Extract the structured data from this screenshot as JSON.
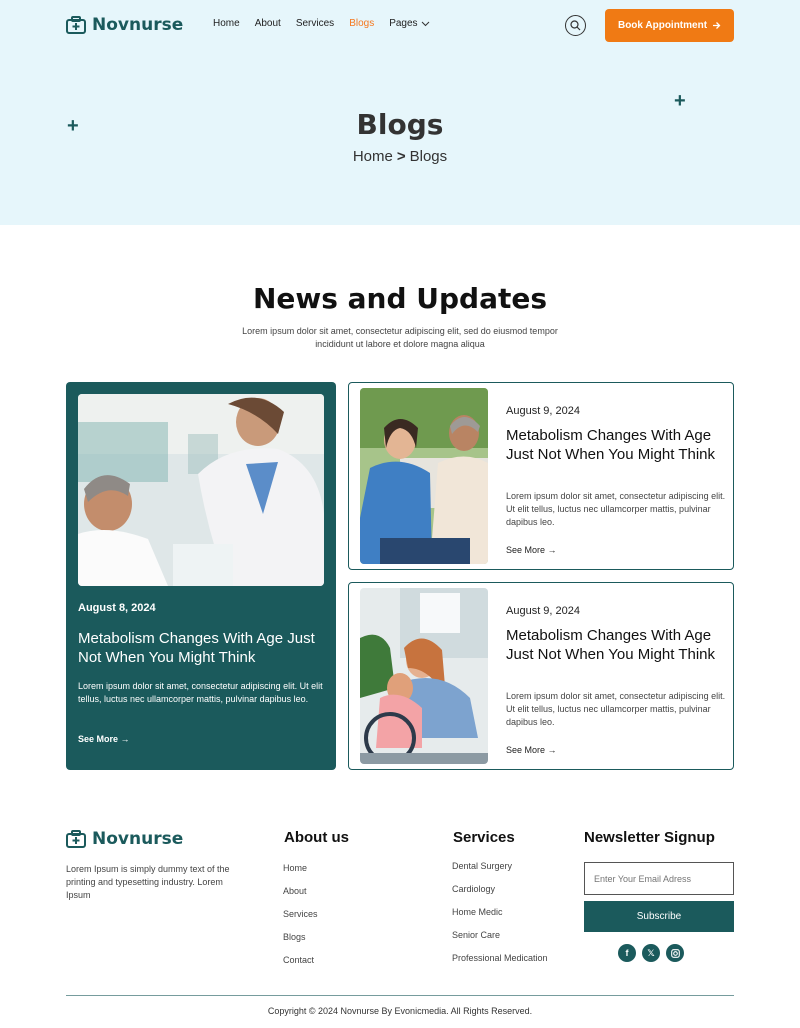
{
  "brand": {
    "name": "Novnurse"
  },
  "nav": {
    "items": [
      "Home",
      "About",
      "Services",
      "Blogs",
      "Pages"
    ],
    "active": "Blogs",
    "book_label": "Book Appointment"
  },
  "hero": {
    "title": "Blogs",
    "crumb_home": "Home",
    "crumb_sep": ">",
    "crumb_current": "Blogs"
  },
  "news": {
    "title": "News and Updates",
    "subtitle": "Lorem ipsum dolor sit amet, consectetur adipiscing elit, sed do eiusmod tempor incididunt ut labore et dolore magna aliqua",
    "featured": {
      "date": "August 8, 2024",
      "title": "Metabolism Changes With Age Just Not When You Might Think",
      "text": "Lorem ipsum dolor sit amet, consectetur adipiscing elit. Ut elit tellus, luctus nec ullamcorper mattis, pulvinar dapibus leo.",
      "more": "See More"
    },
    "cards": [
      {
        "date": "August 9, 2024",
        "title": "Metabolism Changes With Age Just Not When You Might Think",
        "text": "Lorem ipsum dolor sit amet, consectetur adipiscing elit. Ut elit tellus, luctus nec ullamcorper mattis, pulvinar dapibus leo.",
        "more": "See More"
      },
      {
        "date": "August 9, 2024",
        "title": "Metabolism Changes With Age Just Not When You Might Think",
        "text": "Lorem ipsum dolor sit amet, consectetur adipiscing elit. Ut elit tellus, luctus nec ullamcorper mattis, pulvinar dapibus leo.",
        "more": "See More"
      }
    ]
  },
  "footer": {
    "brand": "Novnurse",
    "desc": "Lorem Ipsum is simply dummy text of the printing and typesetting industry. Lorem Ipsum",
    "about": {
      "title": "About us",
      "links": [
        "Home",
        "About",
        "Services",
        "Blogs",
        "Contact"
      ]
    },
    "services": {
      "title": "Services",
      "links": [
        "Dental Surgery",
        "Cardiology",
        "Home Medic",
        "Senior Care",
        "Professional Medication"
      ]
    },
    "newsletter": {
      "title": "Newsletter Signup",
      "placeholder": "Enter Your Email Adress",
      "button": "Subscribe"
    },
    "socials": [
      "facebook-icon",
      "x-icon",
      "instagram-icon"
    ],
    "copyright": "Copyright © 2024 Novnurse By Evonicmedia. All Rights Reserved."
  },
  "colors": {
    "primary": "#1b5a5c",
    "accent": "#f07a14",
    "hero_bg": "#e6f6fb"
  }
}
